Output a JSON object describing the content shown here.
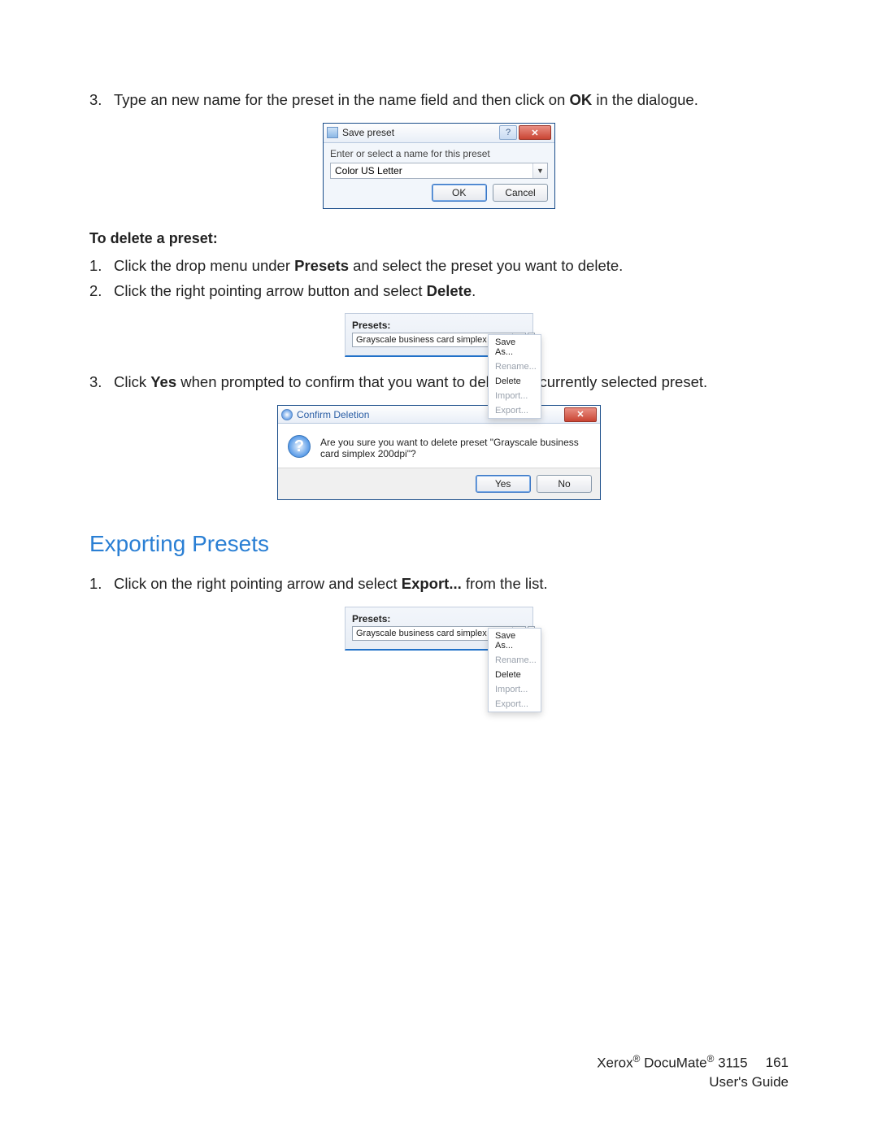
{
  "steps_top": {
    "s3_num": "3.",
    "s3a": "Type an new name for the preset in the name field and then click on ",
    "s3b": "OK",
    "s3c": " in the dialogue."
  },
  "save_dialog": {
    "title": "Save preset",
    "label": "Enter or select a name for this preset",
    "value": "Color US Letter",
    "ok": "OK",
    "cancel": "Cancel"
  },
  "delete_section": {
    "heading": "To delete a preset:",
    "s1_num": "1.",
    "s1a": "Click the drop menu under ",
    "s1b": "Presets",
    "s1c": " and select the preset you want to delete.",
    "s2_num": "2.",
    "s2a": "Click the right pointing arrow button and select ",
    "s2b": "Delete",
    "s2c": ".",
    "s3_num": "3.",
    "s3a": "Click ",
    "s3b": "Yes",
    "s3c": " when prompted to confirm that you want to delete the currently selected preset."
  },
  "presets_fig": {
    "label": "Presets:",
    "selected": "Grayscale business card simplex 200c",
    "menu": {
      "save_as": "Save As...",
      "rename": "Rename...",
      "delete": "Delete",
      "import": "Import...",
      "export": "Export..."
    }
  },
  "confirm_dialog": {
    "title": "Confirm Deletion",
    "message": "Are you sure you want to delete preset \"Grayscale business card simplex 200dpi\"?",
    "yes": "Yes",
    "no": "No"
  },
  "export_section": {
    "title": "Exporting Presets",
    "s1_num": "1.",
    "s1a": "Click on the right pointing arrow and select ",
    "s1b": "Export...",
    "s1c": " from the list."
  },
  "footer": {
    "product_a": "Xerox",
    "product_b": " DocuMate",
    "product_c": " 3115",
    "guide": "User's Guide",
    "page": "161"
  }
}
